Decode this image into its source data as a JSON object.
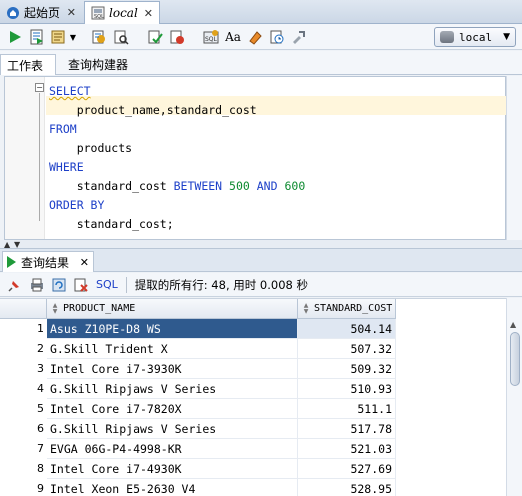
{
  "doc_tabs": [
    {
      "label": "起始页",
      "icon": "home-page-icon"
    },
    {
      "label": "local",
      "icon": "sql-worksheet-icon"
    }
  ],
  "toolbar": {
    "icons": [
      "run-statement-icon",
      "run-script-icon",
      "autotrace-icon",
      "explain-plan-icon",
      "sql-tuning-icon",
      "commit-icon",
      "rollback-icon",
      "unshared-sql-icon",
      "to-upper-lower-icon",
      "clear-icon",
      "history-icon",
      "sql-formatter-icon"
    ],
    "connection": "local"
  },
  "sub_tabs": {
    "worksheet": "工作表",
    "query_builder": "查询构建器"
  },
  "editor": {
    "lines": [
      [
        {
          "t": "SELECT",
          "c": "kw"
        }
      ],
      [
        {
          "t": "    product_name,standard_cost",
          "c": "txt"
        }
      ],
      [
        {
          "t": "FROM",
          "c": "kw"
        }
      ],
      [
        {
          "t": "    products",
          "c": "txt"
        }
      ],
      [
        {
          "t": "WHERE",
          "c": "kw"
        }
      ],
      [
        {
          "t": "    standard_cost ",
          "c": "txt"
        },
        {
          "t": "BETWEEN",
          "c": "kw"
        },
        {
          "t": " ",
          "c": "txt"
        },
        {
          "t": "500",
          "c": "num"
        },
        {
          "t": " ",
          "c": "txt"
        },
        {
          "t": "AND",
          "c": "kw"
        },
        {
          "t": " ",
          "c": "txt"
        },
        {
          "t": "600",
          "c": "num"
        }
      ],
      [
        {
          "t": "ORDER BY",
          "c": "kw"
        }
      ],
      [
        {
          "t": "    standard_cost;",
          "c": "txt"
        }
      ]
    ]
  },
  "results": {
    "tab_label": "查询结果",
    "sql_label": "SQL",
    "status": "提取的所有行: 48, 用时 0.008 秒",
    "columns": [
      "PRODUCT_NAME",
      "STANDARD_COST"
    ],
    "rows": [
      {
        "n": "1",
        "name": "Asus Z10PE-D8 WS",
        "cost": "504.14"
      },
      {
        "n": "2",
        "name": "G.Skill Trident X",
        "cost": "507.32"
      },
      {
        "n": "3",
        "name": "Intel Core i7-3930K",
        "cost": "509.32"
      },
      {
        "n": "4",
        "name": "G.Skill Ripjaws V Series",
        "cost": "510.93"
      },
      {
        "n": "5",
        "name": "Intel Core i7-7820X",
        "cost": "511.1"
      },
      {
        "n": "6",
        "name": "G.Skill Ripjaws V Series",
        "cost": "517.78"
      },
      {
        "n": "7",
        "name": "EVGA 06G-P4-4998-KR",
        "cost": "521.03"
      },
      {
        "n": "8",
        "name": "Intel Core i7-4930K",
        "cost": "527.69"
      },
      {
        "n": "9",
        "name": "Intel Xeon E5-2630 V4",
        "cost": "528.95"
      }
    ]
  }
}
